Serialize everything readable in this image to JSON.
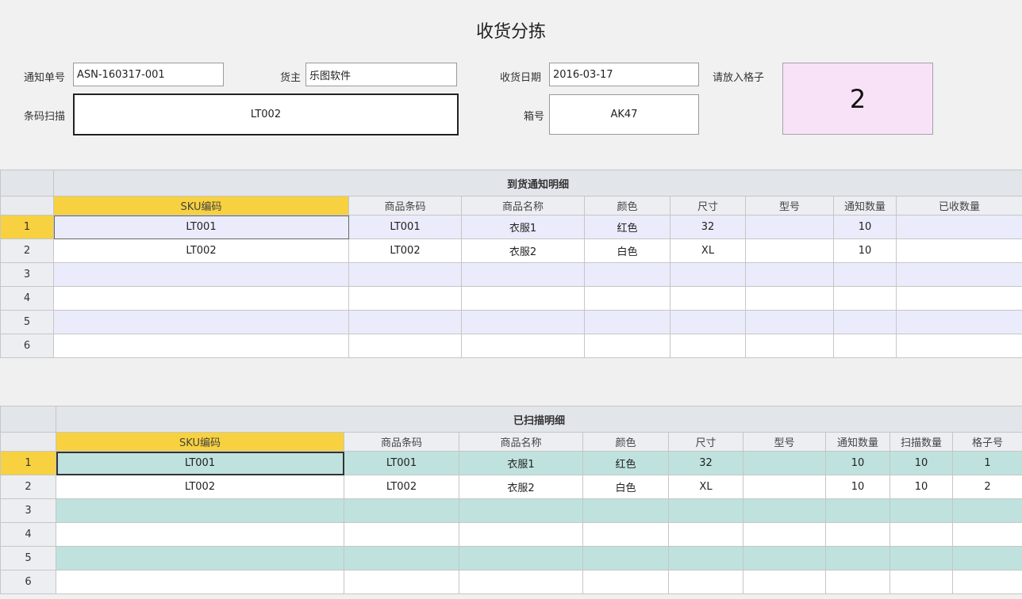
{
  "title": "收货分拣",
  "form": {
    "notice_no_label": "通知单号",
    "notice_no_value": "ASN-160317-001",
    "owner_label": "货主",
    "owner_value": "乐图软件",
    "date_label": "收货日期",
    "date_value": "2016-03-17",
    "slot_label": "请放入格子",
    "slot_value": "2",
    "scan_label": "条码扫描",
    "scan_value": "LT002",
    "box_label": "箱号",
    "box_value": "AK47"
  },
  "grid1": {
    "title": "到货通知明细",
    "columns": [
      "SKU编码",
      "商品条码",
      "商品名称",
      "颜色",
      "尺寸",
      "型号",
      "通知数量",
      "已收数量"
    ],
    "row_numbers": [
      "1",
      "2",
      "3",
      "4",
      "5",
      "6"
    ],
    "rows": [
      [
        "LT001",
        "LT001",
        "衣服1",
        "红色",
        "32",
        "",
        "10",
        ""
      ],
      [
        "LT002",
        "LT002",
        "衣服2",
        "白色",
        "XL",
        "",
        "10",
        ""
      ],
      [
        "",
        "",
        "",
        "",
        "",
        "",
        "",
        ""
      ],
      [
        "",
        "",
        "",
        "",
        "",
        "",
        "",
        ""
      ],
      [
        "",
        "",
        "",
        "",
        "",
        "",
        "",
        ""
      ],
      [
        "",
        "",
        "",
        "",
        "",
        "",
        "",
        ""
      ]
    ]
  },
  "grid2": {
    "title": "已扫描明细",
    "columns": [
      "SKU编码",
      "商品条码",
      "商品名称",
      "颜色",
      "尺寸",
      "型号",
      "通知数量",
      "扫描数量",
      "格子号"
    ],
    "row_numbers": [
      "1",
      "2",
      "3",
      "4",
      "5",
      "6"
    ],
    "rows": [
      [
        "LT001",
        "LT001",
        "衣服1",
        "红色",
        "32",
        "",
        "10",
        "10",
        "1"
      ],
      [
        "LT002",
        "LT002",
        "衣服2",
        "白色",
        "XL",
        "",
        "10",
        "10",
        "2"
      ],
      [
        "",
        "",
        "",
        "",
        "",
        "",
        "",
        "",
        ""
      ],
      [
        "",
        "",
        "",
        "",
        "",
        "",
        "",
        "",
        ""
      ],
      [
        "",
        "",
        "",
        "",
        "",
        "",
        "",
        "",
        ""
      ],
      [
        "",
        "",
        "",
        "",
        "",
        "",
        "",
        "",
        ""
      ]
    ]
  },
  "colors": {
    "selection_yellow": "#f7d13f",
    "grid1_alt_row": "#eaecfb",
    "grid2_alt_row": "#bfe2de",
    "slot_bg": "#f8e2f8"
  }
}
